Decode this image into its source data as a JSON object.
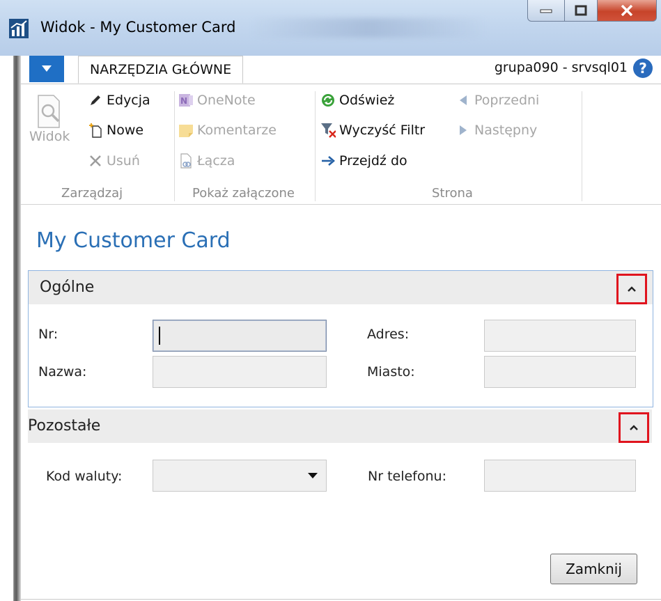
{
  "window": {
    "title": "Widok - My Customer Card"
  },
  "ribbon": {
    "tab_home": "NARZĘDZIA GŁÓWNE",
    "server": "grupa090 - srvsql01",
    "help": "?",
    "groups": {
      "manage": {
        "label": "Zarządzaj",
        "view": "Widok",
        "edit": "Edycja",
        "new": "Nowe",
        "delete": "Usuń"
      },
      "attachments": {
        "label": "Pokaż załączone",
        "onenote": "OneNote",
        "comments": "Komentarze",
        "links": "Łącza"
      },
      "page": {
        "label": "Strona",
        "refresh": "Odśwież",
        "clear_filter": "Wyczyść Filtr",
        "goto": "Przejdź do",
        "previous": "Poprzedni",
        "next": "Następny"
      }
    }
  },
  "page": {
    "title": "My Customer Card",
    "sections": {
      "general": {
        "title": "Ogólne",
        "fields": {
          "no": {
            "label": "Nr:",
            "value": ""
          },
          "name": {
            "label": "Nazwa:",
            "value": ""
          },
          "address": {
            "label": "Adres:",
            "value": ""
          },
          "city": {
            "label": "Miasto:",
            "value": ""
          }
        }
      },
      "other": {
        "title": "Pozostałe",
        "fields": {
          "currency": {
            "label": "Kod waluty:",
            "value": ""
          },
          "phone": {
            "label": "Nr telefonu:",
            "value": ""
          }
        }
      }
    },
    "close_button": "Zamknij"
  },
  "colors": {
    "accent": "#2a6fb5",
    "highlight_box": "#e0141e",
    "menu_button": "#1f6fc5"
  }
}
